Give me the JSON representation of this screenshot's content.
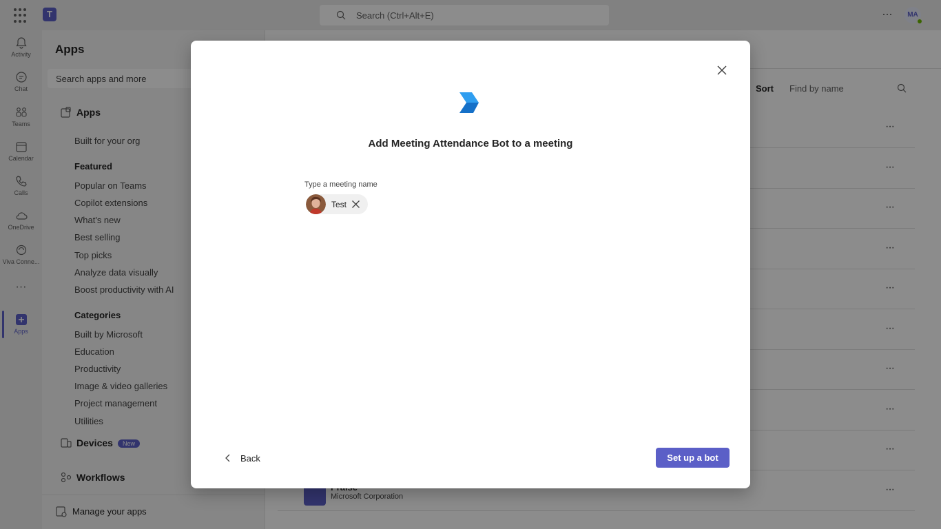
{
  "topbar": {
    "search_placeholder": "Search (Ctrl+Alt+E)",
    "avatar_initials": "MA"
  },
  "rail": {
    "items": [
      {
        "label": "Activity",
        "icon": "bell-icon"
      },
      {
        "label": "Chat",
        "icon": "chat-icon"
      },
      {
        "label": "Teams",
        "icon": "teams-icon"
      },
      {
        "label": "Calendar",
        "icon": "calendar-icon"
      },
      {
        "label": "Calls",
        "icon": "phone-icon"
      },
      {
        "label": "OneDrive",
        "icon": "cloud-icon"
      },
      {
        "label": "Viva Conne...",
        "icon": "viva-icon"
      },
      {
        "label": "Apps",
        "icon": "apps-plus-icon"
      }
    ]
  },
  "panel": {
    "title": "Apps",
    "search_placeholder": "Search apps and more",
    "apps_section": "Apps",
    "built_for_org": "Built for your org",
    "featured_heading": "Featured",
    "featured": [
      "Popular on Teams",
      "Copilot extensions",
      "What's new",
      "Best selling",
      "Top picks",
      "Analyze data visually",
      "Boost productivity with AI"
    ],
    "categories_heading": "Categories",
    "categories": [
      "Built by Microsoft",
      "Education",
      "Productivity",
      "Image & video galleries",
      "Project management",
      "Utilities"
    ],
    "devices": "Devices",
    "new_badge": "New",
    "workflows": "Workflows",
    "manage": "Manage your apps"
  },
  "main": {
    "sort_label": "Sort",
    "find_placeholder": "Find by name",
    "last_row_title": "Praise",
    "last_row_sub": "Microsoft Corporation"
  },
  "dialog": {
    "title": "Add Meeting Attendance Bot to a meeting",
    "field_label": "Type a meeting name",
    "chip_text": "Test",
    "back_label": "Back",
    "primary_label": "Set up a bot"
  },
  "colors": {
    "brand": "#5b5fc7",
    "logo_light": "#2f9ef0",
    "logo_dark": "#1570c8"
  }
}
